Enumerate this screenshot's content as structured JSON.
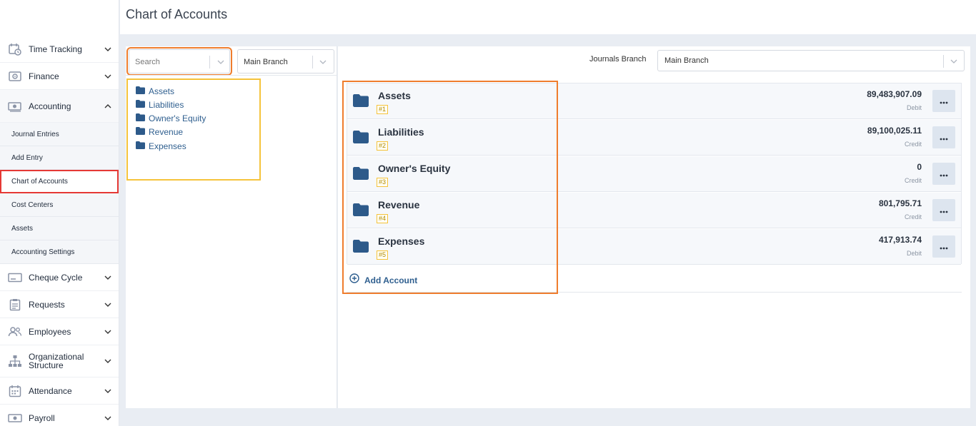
{
  "page": {
    "title": "Chart of Accounts"
  },
  "sidebar": {
    "items_top": [
      {
        "label": "Time Tracking",
        "icon": "calendar-clock-icon"
      },
      {
        "label": "Finance",
        "icon": "safe-icon"
      },
      {
        "label": "Accounting",
        "icon": "cash-icon"
      }
    ],
    "sub_items": [
      {
        "label": "Journal Entries"
      },
      {
        "label": "Add Entry"
      },
      {
        "label": "Chart of Accounts"
      },
      {
        "label": "Cost Centers"
      },
      {
        "label": "Assets"
      },
      {
        "label": "Accounting Settings"
      }
    ],
    "items_bottom": [
      {
        "label": "Cheque Cycle",
        "icon": "cheque-icon"
      },
      {
        "label": "Requests",
        "icon": "clipboard-icon"
      },
      {
        "label": "Employees",
        "icon": "users-icon"
      },
      {
        "label": "Organizational Structure",
        "icon": "org-chart-icon"
      },
      {
        "label": "Attendance",
        "icon": "calendar-icon"
      },
      {
        "label": "Payroll",
        "icon": "money-icon"
      }
    ]
  },
  "filters": {
    "search_placeholder": "Search",
    "branch_value": "Main Branch"
  },
  "tree": {
    "items": [
      {
        "label": "Assets"
      },
      {
        "label": "Liabilities"
      },
      {
        "label": "Owner's Equity"
      },
      {
        "label": "Revenue"
      },
      {
        "label": "Expenses"
      }
    ]
  },
  "journals": {
    "label": "Journals Branch",
    "value": "Main Branch"
  },
  "accounts": [
    {
      "name": "Assets",
      "code": "#1",
      "amount": "89,483,907.09",
      "type": "Debit"
    },
    {
      "name": "Liabilities",
      "code": "#2",
      "amount": "89,100,025.11",
      "type": "Credit"
    },
    {
      "name": "Owner's Equity",
      "code": "#3",
      "amount": "0",
      "type": "Credit"
    },
    {
      "name": "Revenue",
      "code": "#4",
      "amount": "801,795.71",
      "type": "Credit"
    },
    {
      "name": "Expenses",
      "code": "#5",
      "amount": "417,913.74",
      "type": "Debit"
    }
  ],
  "add_account_label": "Add Account",
  "colors": {
    "accent": "#2f5f8f",
    "folder": "#2d5a8a",
    "highlight_orange": "#ef7d2d",
    "highlight_yellow": "#f5c33b",
    "highlight_red": "#e53935"
  }
}
